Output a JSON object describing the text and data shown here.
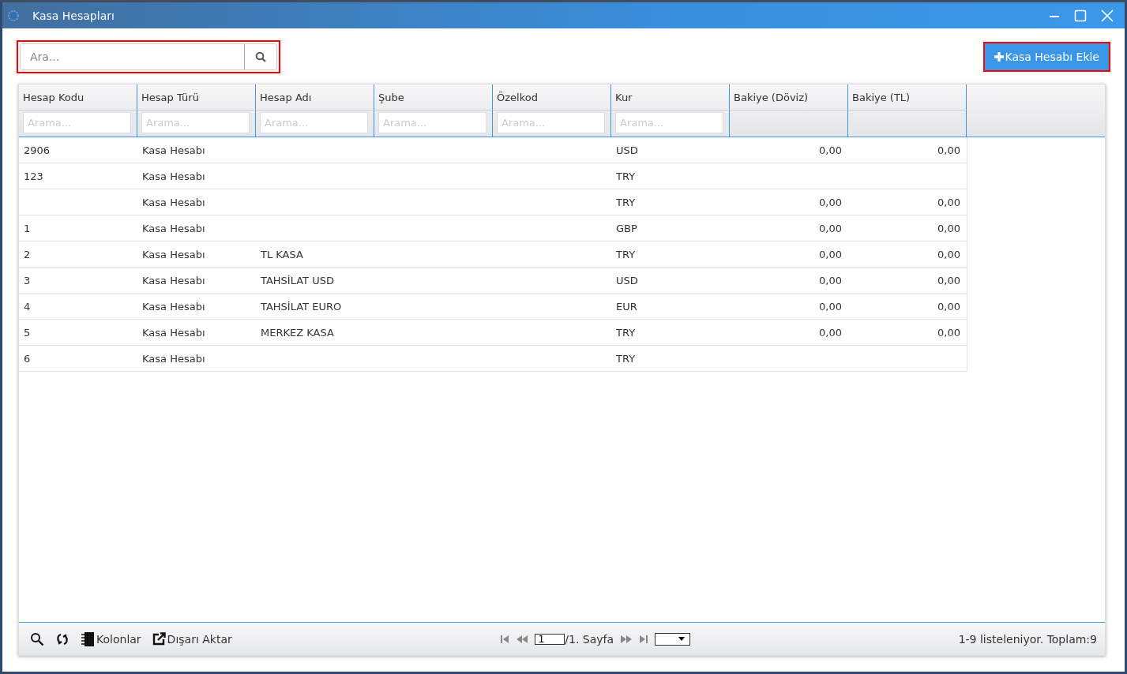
{
  "window": {
    "title": "Kasa Hesapları"
  },
  "search": {
    "placeholder": "Ara...",
    "highlighted": true
  },
  "add_button": {
    "label": "Kasa Hesabı Ekle",
    "highlighted": true
  },
  "table": {
    "columns": [
      {
        "label": "Hesap Kodu",
        "kind": "text",
        "filter_placeholder": "Arama..."
      },
      {
        "label": "Hesap Türü",
        "kind": "text",
        "filter_placeholder": "Arama..."
      },
      {
        "label": "Hesap Adı",
        "kind": "text",
        "filter_placeholder": "Arama..."
      },
      {
        "label": "Şube",
        "kind": "text",
        "filter_placeholder": "Arama..."
      },
      {
        "label": "Özelkod",
        "kind": "text",
        "filter_placeholder": "Arama..."
      },
      {
        "label": "Kur",
        "kind": "text",
        "filter_placeholder": "Arama..."
      },
      {
        "label": "Bakiye (Döviz)",
        "kind": "amount"
      },
      {
        "label": "Bakiye (TL)",
        "kind": "amount"
      }
    ],
    "rows": [
      {
        "cells": [
          "2906",
          "Kasa Hesabı",
          null,
          null,
          null,
          "USD",
          "0,00",
          "0,00"
        ]
      },
      {
        "cells": [
          "123",
          "Kasa Hesabı",
          null,
          null,
          null,
          "TRY",
          null,
          null
        ]
      },
      {
        "cells": [
          null,
          "Kasa Hesabı",
          null,
          null,
          null,
          "TRY",
          "0,00",
          "0,00"
        ]
      },
      {
        "cells": [
          "1",
          "Kasa Hesabı",
          null,
          null,
          null,
          "GBP",
          "0,00",
          "0,00"
        ]
      },
      {
        "cells": [
          "2",
          "Kasa Hesabı",
          "TL KASA",
          null,
          null,
          "TRY",
          "0,00",
          "0,00"
        ]
      },
      {
        "cells": [
          "3",
          "Kasa Hesabı",
          "TAHSİLAT USD",
          null,
          null,
          "USD",
          "0,00",
          "0,00"
        ]
      },
      {
        "cells": [
          "4",
          "Kasa Hesabı",
          "TAHSİLAT EURO",
          null,
          null,
          "EUR",
          "0,00",
          "0,00"
        ]
      },
      {
        "cells": [
          "5",
          "Kasa Hesabı",
          "MERKEZ KASA",
          null,
          null,
          "TRY",
          "0,00",
          "0,00"
        ]
      },
      {
        "cells": [
          "6",
          "Kasa Hesabı",
          null,
          null,
          null,
          "TRY",
          null,
          null
        ]
      }
    ]
  },
  "footer": {
    "columns_label": "Kolonlar",
    "export_label": "Dışarı Aktar",
    "page_value": "1",
    "page_label": "/1. Sayfa",
    "summary": "1-9 listeleniyor. Toplam:9"
  }
}
